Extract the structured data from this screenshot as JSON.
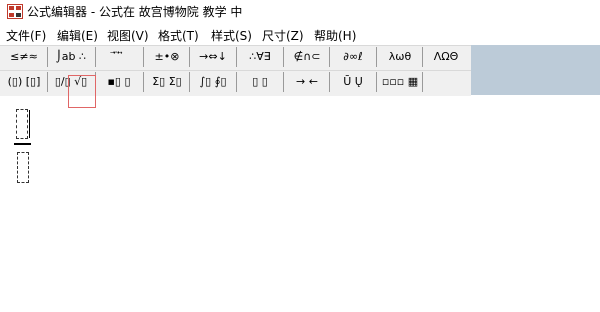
{
  "window": {
    "title": "公式编辑器 - 公式在 故宫博物院 教学 中"
  },
  "menu": [
    {
      "key": "file",
      "label": "文件(F)"
    },
    {
      "key": "edit",
      "label": "编辑(E)"
    },
    {
      "key": "view",
      "label": "视图(V)"
    },
    {
      "key": "format",
      "label": "格式(T)"
    },
    {
      "key": "style",
      "label": "样式(S)"
    },
    {
      "key": "size",
      "label": "尺寸(Z)"
    },
    {
      "key": "help",
      "label": "帮助(H)"
    }
  ],
  "toolbar": {
    "row1": [
      {
        "name": "relations-palette",
        "label": "≤≠≈"
      },
      {
        "name": "spaces-ellipses-palette",
        "label": "⌡ab ∴"
      },
      {
        "name": "embellishments-palette",
        "label": "⃗ ⃛ ⃡"
      },
      {
        "name": "operators-palette",
        "label": "±•⊗"
      },
      {
        "name": "arrows-palette",
        "label": "→⇔↓"
      },
      {
        "name": "logic-palette",
        "label": "∴∀∃"
      },
      {
        "name": "set-theory-palette",
        "label": "∉∩⊂"
      },
      {
        "name": "misc-symbols-palette",
        "label": "∂∞ℓ"
      },
      {
        "name": "greek-lowercase-palette",
        "label": "λωθ"
      },
      {
        "name": "greek-uppercase-palette",
        "label": "ΛΩΘ"
      }
    ],
    "row2": [
      {
        "name": "fences-templates",
        "label": "(▯) [▯]"
      },
      {
        "name": "fraction-radical-templates",
        "label": "▯/▯ √▯"
      },
      {
        "name": "subscript-superscript-templates",
        "label": "▪▯ ▯"
      },
      {
        "name": "summation-templates",
        "label": "Σ▯ Σ▯"
      },
      {
        "name": "integral-templates",
        "label": "∫▯ ∮▯"
      },
      {
        "name": "underbar-overbar-templates",
        "label": "▯ ▯"
      },
      {
        "name": "labeled-arrow-templates",
        "label": "→ ←"
      },
      {
        "name": "products-set-templates",
        "label": "Ū Ų"
      },
      {
        "name": "matrix-templates",
        "label": "▫▫▫ ▦"
      }
    ]
  }
}
